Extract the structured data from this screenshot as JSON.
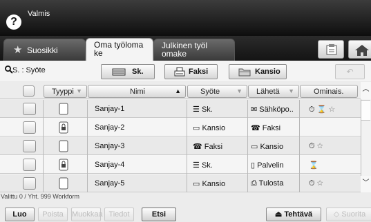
{
  "status": {
    "text": "Valmis",
    "help_symbol": "?"
  },
  "tabs": [
    {
      "label": "Suosikki",
      "icon": "star-icon"
    },
    {
      "label": "Oma työloma\nke"
    },
    {
      "label": "Julkinen työl\nomake"
    }
  ],
  "filter": {
    "label": "S. : Syöte",
    "buttons": [
      {
        "label": "Sk.",
        "icon": "scanner-icon"
      },
      {
        "label": "Faksi",
        "icon": "fax-icon"
      },
      {
        "label": "Kansio",
        "icon": "folder-icon"
      }
    ],
    "undo_symbol": "↶"
  },
  "table": {
    "headers": {
      "type": "Tyyppi",
      "name": "Nimi",
      "input": "Syöte",
      "send": "Lähetä",
      "features": "Ominais."
    },
    "sort_indicator": "▲",
    "dropdown_indicator": "▼",
    "rows": [
      {
        "name": "Sanjay-1",
        "input": "Sk.",
        "send": "Sähköpo..",
        "features": [
          "timer-icon",
          "hourglass-icon",
          "star-icon"
        ]
      },
      {
        "name": "Sanjay-2",
        "input": "Kansio",
        "send": "Faksi",
        "features": []
      },
      {
        "name": "Sanjay-3",
        "input": "Faksi",
        "send": "Kansio",
        "features": [
          "timer-icon",
          "star-icon"
        ]
      },
      {
        "name": "Sanjay-4",
        "input": "Sk.",
        "send": "Palvelin",
        "features": [
          "hourglass-icon"
        ]
      },
      {
        "name": "Sanjay-5",
        "input": "Kansio",
        "send": "Tulosta",
        "features": [
          "timer-icon",
          "star-icon"
        ]
      }
    ]
  },
  "footer": {
    "selection_info": "Valittu 0 / Yht. 999 Workform",
    "buttons": {
      "new": "Luo",
      "delete": "Poista",
      "edit": "Muokkaa",
      "details": "Tiedot",
      "search": "Etsi",
      "task": "Tehtävä",
      "run": "Suorita"
    },
    "task_symbol": "⏏",
    "run_symbol": "◇"
  },
  "colors": {
    "status_bar": "#1a1a1a",
    "active_tab": "#f4f4f4",
    "row_odd": "#e9e9e9",
    "row_even": "#f5f5f5"
  }
}
